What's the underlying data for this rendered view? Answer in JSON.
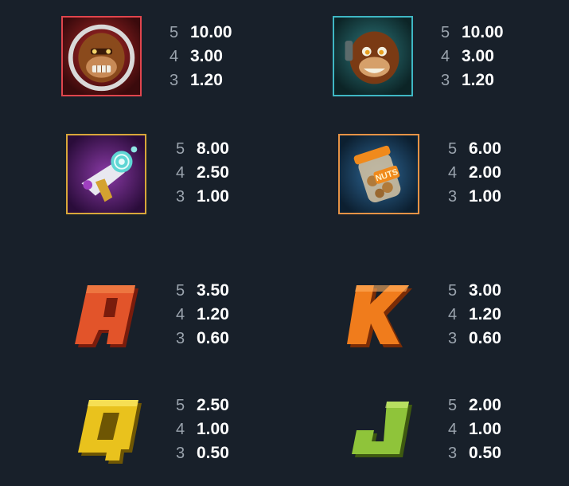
{
  "paytable": {
    "symbols": [
      {
        "id": "red-monkey",
        "icon": "red-monkey-icon",
        "color": "#e0454d",
        "pays": [
          {
            "count": "5",
            "value": "10.00"
          },
          {
            "count": "4",
            "value": "3.00"
          },
          {
            "count": "3",
            "value": "1.20"
          }
        ]
      },
      {
        "id": "blue-monkey",
        "icon": "blue-monkey-icon",
        "color": "#3fb7c4",
        "pays": [
          {
            "count": "5",
            "value": "10.00"
          },
          {
            "count": "4",
            "value": "3.00"
          },
          {
            "count": "3",
            "value": "1.20"
          }
        ]
      },
      {
        "id": "ray-gun",
        "icon": "ray-gun-icon",
        "color": "#d8a73a",
        "pays": [
          {
            "count": "5",
            "value": "8.00"
          },
          {
            "count": "4",
            "value": "2.50"
          },
          {
            "count": "3",
            "value": "1.00"
          }
        ]
      },
      {
        "id": "nuts-jar",
        "icon": "nuts-jar-icon",
        "color": "#e69346",
        "pays": [
          {
            "count": "5",
            "value": "6.00"
          },
          {
            "count": "4",
            "value": "2.00"
          },
          {
            "count": "3",
            "value": "1.00"
          }
        ]
      },
      {
        "id": "letter-a",
        "icon": "letter-a-icon",
        "letter": "A",
        "color": "#e2542a",
        "pays": [
          {
            "count": "5",
            "value": "3.50"
          },
          {
            "count": "4",
            "value": "1.20"
          },
          {
            "count": "3",
            "value": "0.60"
          }
        ]
      },
      {
        "id": "letter-k",
        "icon": "letter-k-icon",
        "letter": "K",
        "color": "#f07c1c",
        "pays": [
          {
            "count": "5",
            "value": "3.00"
          },
          {
            "count": "4",
            "value": "1.20"
          },
          {
            "count": "3",
            "value": "0.60"
          }
        ]
      },
      {
        "id": "letter-q",
        "icon": "letter-q-icon",
        "letter": "Q",
        "color": "#e9c21d",
        "pays": [
          {
            "count": "5",
            "value": "2.50"
          },
          {
            "count": "4",
            "value": "1.00"
          },
          {
            "count": "3",
            "value": "0.50"
          }
        ]
      },
      {
        "id": "letter-j",
        "icon": "letter-j-icon",
        "letter": "J",
        "color": "#8fc43a",
        "pays": [
          {
            "count": "5",
            "value": "2.00"
          },
          {
            "count": "4",
            "value": "1.00"
          },
          {
            "count": "3",
            "value": "0.50"
          }
        ]
      }
    ]
  }
}
